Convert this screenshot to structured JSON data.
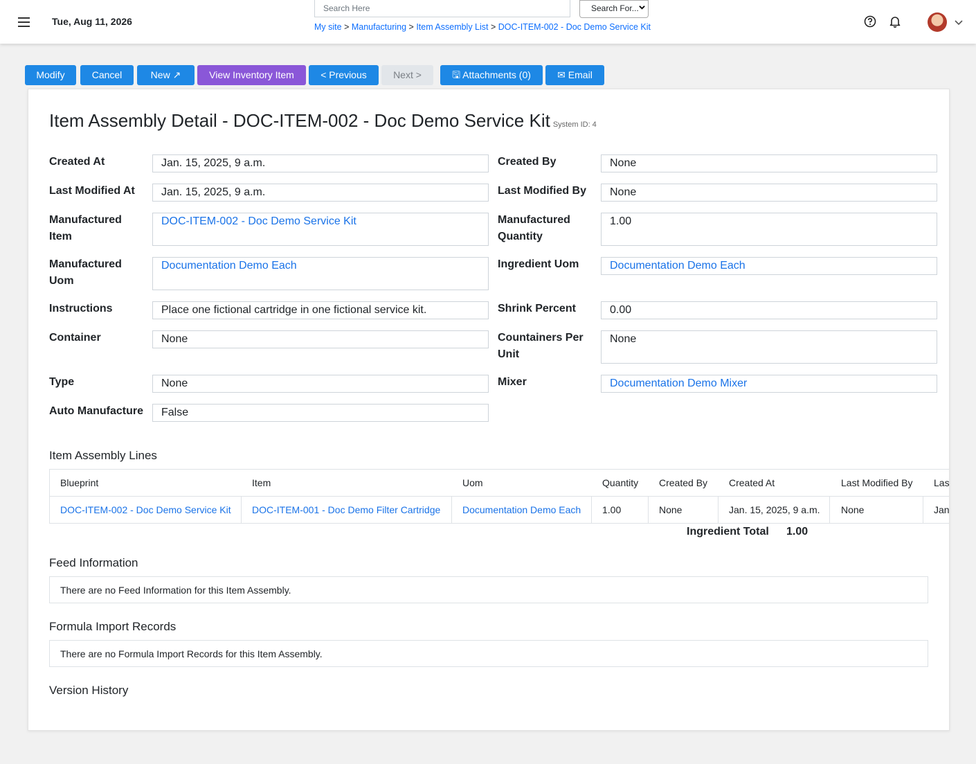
{
  "header": {
    "date": "Tue, Aug 11, 2026",
    "search_placeholder": "Search Here",
    "search_select": "Search For...",
    "breadcrumb": [
      {
        "label": "My site"
      },
      {
        "label": "Manufacturing"
      },
      {
        "label": "Item Assembly List"
      },
      {
        "label": "DOC-ITEM-002 - Doc Demo Service Kit"
      }
    ],
    "separator": " > "
  },
  "toolbar": {
    "modify": "Modify",
    "cancel": "Cancel",
    "new": "New ↗",
    "view_inventory": "View Inventory Item",
    "previous": "< Previous",
    "next": "Next >",
    "attachments": "🖫 Attachments (0)",
    "email": "✉ Email"
  },
  "detail": {
    "title": "Item Assembly Detail - DOC-ITEM-002 - Doc Demo Service Kit",
    "system_id": "System ID: 4",
    "fields": {
      "created_at": {
        "label": "Created At",
        "value": "Jan. 15, 2025, 9 a.m."
      },
      "created_by": {
        "label": "Created By",
        "value": "None"
      },
      "last_modified_at": {
        "label": "Last Modified At",
        "value": "Jan. 15, 2025, 9 a.m."
      },
      "last_modified_by": {
        "label": "Last Modified By",
        "value": "None"
      },
      "manufactured_item": {
        "label_1": "Manufactured",
        "label_2": "Item",
        "value": "DOC-ITEM-002 - Doc Demo Service Kit"
      },
      "manufactured_quantity": {
        "label_1": "Manufactured",
        "label_2": "Quantity",
        "value": "1.00"
      },
      "manufactured_uom": {
        "label_1": "Manufactured",
        "label_2": "Uom",
        "value": "Documentation Demo Each"
      },
      "ingredient_uom": {
        "label": "Ingredient Uom",
        "value": "Documentation Demo Each"
      },
      "instructions": {
        "label": "Instructions",
        "value": "Place one fictional cartridge in one fictional service kit."
      },
      "shrink_percent": {
        "label": "Shrink Percent",
        "value": "0.00"
      },
      "container": {
        "label": "Container",
        "value": "None"
      },
      "containers_per_unit": {
        "label_1": "Countainers Per",
        "label_2": "Unit",
        "value": "None"
      },
      "type": {
        "label": "Type",
        "value": "None"
      },
      "mixer": {
        "label": "Mixer",
        "value": "Documentation Demo Mixer"
      },
      "auto_manufacture": {
        "label": "Auto Manufacture",
        "value": "False"
      }
    }
  },
  "lines": {
    "title": "Item Assembly Lines",
    "columns": [
      "Blueprint",
      "Item",
      "Uom",
      "Quantity",
      "Created By",
      "Created At",
      "Last Modified By",
      "Las"
    ],
    "rows": [
      [
        "DOC-ITEM-002 - Doc Demo Service Kit",
        "DOC-ITEM-001 - Doc Demo Filter Cartridge",
        "Documentation Demo Each",
        "1.00",
        "None",
        "Jan. 15, 2025, 9 a.m.",
        "None",
        "Jan"
      ]
    ],
    "total_label": "Ingredient Total",
    "total_value": "1.00"
  },
  "feed": {
    "title": "Feed Information",
    "empty": "There are no Feed Information for this Item Assembly."
  },
  "formula": {
    "title": "Formula Import Records",
    "empty": "There are no Formula Import Records for this Item Assembly."
  },
  "version": {
    "title": "Version History"
  }
}
